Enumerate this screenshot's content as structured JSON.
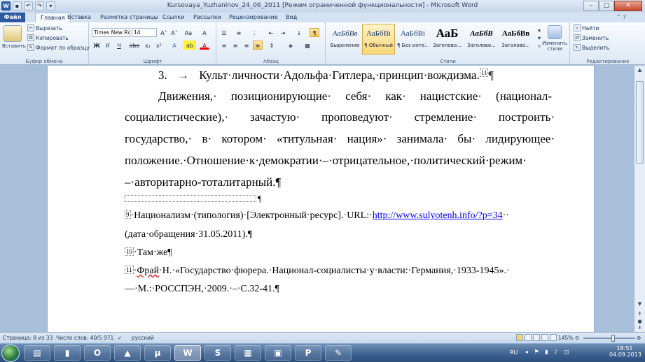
{
  "window": {
    "title": "Kursovaya_Yuzhaninov_24_06_2011 [Режим ограниченной функциональности] - Microsoft Word",
    "qat_icons": [
      "word-app-icon",
      "save-icon",
      "undo-icon",
      "redo-icon",
      "customize-qat-icon"
    ],
    "controls": {
      "minimize": "–",
      "maximize": "□",
      "close": "✕"
    }
  },
  "tabs": [
    {
      "label": "Файл",
      "active": false
    },
    {
      "label": "Главная",
      "active": true
    },
    {
      "label": "Вставка",
      "active": false
    },
    {
      "label": "Разметка страницы",
      "active": false
    },
    {
      "label": "Ссылки",
      "active": false
    },
    {
      "label": "Рассылки",
      "active": false
    },
    {
      "label": "Рецензирование",
      "active": false
    },
    {
      "label": "Вид",
      "active": false
    }
  ],
  "ribbon": {
    "clipboard": {
      "caption": "Буфер обмена",
      "paste": "Вставить",
      "cut": "Вырезать",
      "copy": "Копировать",
      "format_painter": "Формат по образцу"
    },
    "font": {
      "caption": "Шрифт",
      "font_name": "Times New Rc",
      "font_size": "14",
      "grow": "A˄",
      "shrink": "A˅",
      "change_case": "Aa",
      "clear": "A",
      "bold": "Ж",
      "italic": "К",
      "underline": "Ч",
      "strike": "abe",
      "subscript": "x₂",
      "superscript": "x²",
      "effects": "A",
      "highlight": "ab",
      "color": "A"
    },
    "paragraph": {
      "caption": "Абзац",
      "pilcrow": "¶"
    },
    "styles": {
      "caption": "Стили",
      "items": [
        {
          "preview": "АаБбВв",
          "name": "Выделение",
          "selected": false
        },
        {
          "preview": "АаБбВі",
          "name": "¶ Обычный",
          "selected": true
        },
        {
          "preview": "АаБбВі",
          "name": "¶ Без инте...",
          "selected": false
        },
        {
          "preview": "АаБ",
          "name": "Заголово...",
          "selected": false
        },
        {
          "preview": "АаБбВ",
          "name": "Заголово...",
          "selected": false
        },
        {
          "preview": "АаБбВв",
          "name": "Заголово...",
          "selected": false
        }
      ],
      "change_styles": "Изменить стили"
    },
    "editing": {
      "caption": "Редактирование",
      "find": "Найти",
      "replace": "Заменить",
      "select": "Выделить"
    }
  },
  "document": {
    "heading": {
      "number": "3.",
      "arrow": "→",
      "text": "Культ·личности·Адольфа·Гитлера,·принцип·вождизма.",
      "ref": "11",
      "mark": "¶"
    },
    "paragraph": [
      "Движения,· позиционирующие· себя· как· нацистские· (национал-",
      "социалистические),· зачастую· проповедуют· стремление· построить·",
      "государство,· в· котором· «титульная· нация»· занимала· бы· лидирующее·",
      "положение.·Отношение·к·демократии·–·отрицательное,·политический·режим·"
    ],
    "paragraph_last": "–·авторитарно-тоталитарный.¶",
    "separator_mark": "¶",
    "footnotes": [
      {
        "ref": "9",
        "text": "·Национализм·(типология)·[Электронный·ресурс].·URL:·",
        "link": "http://www.sulyotenh.info/?p=34",
        "tail": "··"
      },
      {
        "continuation": "(дата·обращения·31.05.2011).¶"
      },
      {
        "ref": "10",
        "text": "·Там·же¶"
      },
      {
        "ref": "11",
        "prefix": "·",
        "squig": "Фрай",
        "text": "·Н.·«Государство·фюрера.·Национал-социалисты·у·власти:·Германия,·1933-1945».·"
      },
      {
        "continuation": "—·М.:·РОССПЭН,·2009.·–·С.32-41.¶"
      }
    ]
  },
  "status": {
    "page": "Страница: 8 из 33",
    "words": "Число слов: 40/5 971",
    "language": "русский",
    "zoom": "145%",
    "zoom_level": 0.58
  },
  "taskbar": {
    "items": [
      {
        "icon": "explorer-icon",
        "glyph": "▤",
        "active": false
      },
      {
        "icon": "save-app-icon",
        "glyph": "▮",
        "active": false
      },
      {
        "icon": "opera-icon",
        "glyph": "O",
        "active": false
      },
      {
        "icon": "media-icon",
        "glyph": "▲",
        "active": false
      },
      {
        "icon": "torrent-icon",
        "glyph": "µ",
        "active": false
      },
      {
        "icon": "word-icon",
        "glyph": "W",
        "active": true
      },
      {
        "icon": "skype-icon",
        "glyph": "S",
        "active": false
      },
      {
        "icon": "calendar-icon",
        "glyph": "▦",
        "active": false
      },
      {
        "icon": "recorder-icon",
        "glyph": "▣",
        "active": false
      },
      {
        "icon": "powerpoint-icon",
        "glyph": "P",
        "active": false
      },
      {
        "icon": "paint-icon",
        "glyph": "✎",
        "active": false
      }
    ],
    "lang": "RU",
    "time": "18:51",
    "date": "04.09.2013"
  },
  "colors": {
    "file_tab": "#2b5aa3",
    "ribbon_bg": "#dde8f5",
    "doc_bg": "#a8bfd9",
    "link": "#0000ee"
  }
}
